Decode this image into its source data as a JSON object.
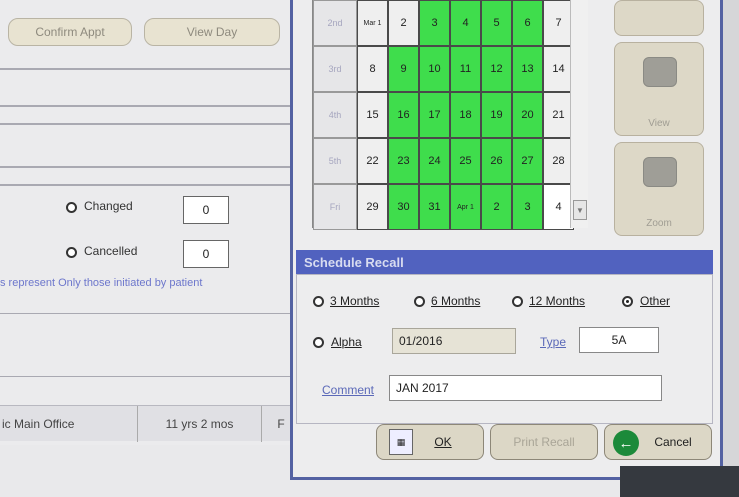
{
  "background_window": {
    "buttons": [
      "Confirm Appt",
      "View Day"
    ],
    "changed": {
      "label": "Changed",
      "value": "0"
    },
    "cancelled": {
      "label": "Cancelled",
      "value": "0"
    },
    "note": "s represent Only those initiated by patient",
    "status": {
      "office": "ic Main Office",
      "age": "11 yrs 2 mos",
      "sex": "F"
    }
  },
  "calendar": {
    "week_headers": [
      "2nd",
      "3rd",
      "4th",
      "5th",
      "Fri"
    ],
    "rows": [
      [
        {
          "t": "Mar 1",
          "c": "gray"
        },
        {
          "t": "2",
          "c": "gray"
        },
        {
          "t": "3",
          "c": "green"
        },
        {
          "t": "4",
          "c": "green"
        },
        {
          "t": "5",
          "c": "green"
        },
        {
          "t": "6",
          "c": "green"
        },
        {
          "t": "7",
          "c": "gray"
        }
      ],
      [
        {
          "t": "8",
          "c": "gray"
        },
        {
          "t": "9",
          "c": "green"
        },
        {
          "t": "10",
          "c": "green"
        },
        {
          "t": "11",
          "c": "green"
        },
        {
          "t": "12",
          "c": "green"
        },
        {
          "t": "13",
          "c": "green"
        },
        {
          "t": "14",
          "c": "gray"
        }
      ],
      [
        {
          "t": "15",
          "c": "gray"
        },
        {
          "t": "16",
          "c": "green"
        },
        {
          "t": "17",
          "c": "green"
        },
        {
          "t": "18",
          "c": "green"
        },
        {
          "t": "19",
          "c": "green"
        },
        {
          "t": "20",
          "c": "green"
        },
        {
          "t": "21",
          "c": "gray"
        }
      ],
      [
        {
          "t": "22",
          "c": "gray"
        },
        {
          "t": "23",
          "c": "green"
        },
        {
          "t": "24",
          "c": "green"
        },
        {
          "t": "25",
          "c": "green"
        },
        {
          "t": "26",
          "c": "green"
        },
        {
          "t": "27",
          "c": "green"
        },
        {
          "t": "28",
          "c": "gray"
        }
      ],
      [
        {
          "t": "29",
          "c": "gray"
        },
        {
          "t": "30",
          "c": "green"
        },
        {
          "t": "31",
          "c": "green"
        },
        {
          "t": "Apr 1",
          "c": "green"
        },
        {
          "t": "2",
          "c": "green"
        },
        {
          "t": "3",
          "c": "green"
        },
        {
          "t": "4",
          "c": "white"
        }
      ]
    ]
  },
  "side_buttons": [
    "",
    "View",
    "Zoom"
  ],
  "schedule_recall": {
    "title": "Schedule Recall",
    "options": [
      "3 Months",
      "6 Months",
      "12 Months",
      "Other"
    ],
    "selected": "Other",
    "alpha_label": "Alpha",
    "alpha_value": "01/2016",
    "type_label": "Type",
    "type_value": "5A",
    "comment_label": "Comment",
    "comment_value": "JAN 2017"
  },
  "footer": {
    "ok": "OK",
    "print": "Print Recall",
    "cancel": "Cancel"
  },
  "colors": {
    "accent": "#5162bf",
    "green": "#3fdd4c",
    "cancel_icon": "#1c8a3a"
  }
}
